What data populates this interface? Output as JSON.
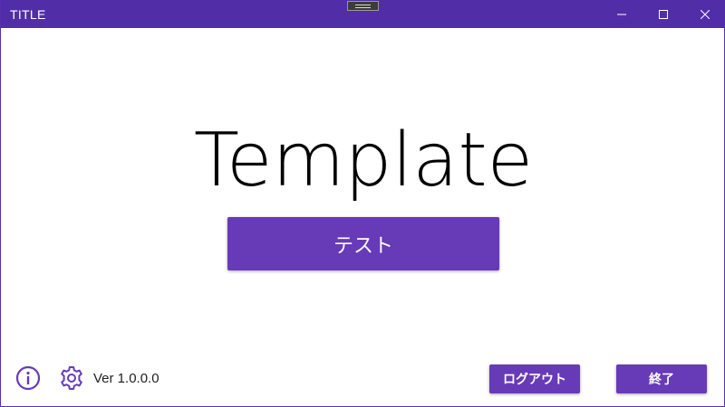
{
  "window": {
    "title": "TITLE",
    "controls": {
      "minimize_icon": "minimize-icon",
      "maximize_icon": "maximize-icon",
      "close_icon": "close-icon"
    }
  },
  "main": {
    "heading": "Template",
    "primary_button_label": "テスト"
  },
  "footer": {
    "info_icon": "info-icon",
    "settings_icon": "gear-icon",
    "version": "Ver 1.0.0.0",
    "logout_label": "ログアウト",
    "exit_label": "終了"
  },
  "colors": {
    "titlebar": "#512da8",
    "accent": "#673ab7",
    "text": "#000000",
    "background": "#ffffff"
  }
}
